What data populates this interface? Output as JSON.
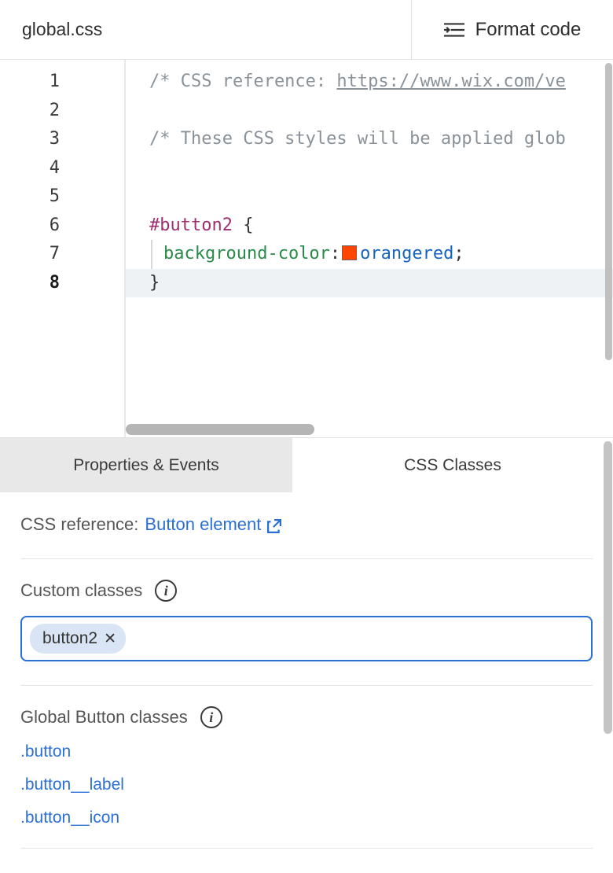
{
  "header": {
    "filename": "global.css",
    "format_label": "Format code"
  },
  "editor": {
    "line_numbers": [
      "1",
      "2",
      "3",
      "4",
      "5",
      "6",
      "7",
      "8"
    ],
    "active_line_index": 7,
    "lines": {
      "l1_comment_prefix": "/* CSS reference: ",
      "l1_link": "https://www.wix.com/ve",
      "l3_comment": "/* These CSS styles will be applied glob",
      "l6_selector": "#button2",
      "l6_brace": " {",
      "l7_property": "background-color",
      "l7_value": "orangered",
      "l8_brace": "}"
    },
    "swatch_color": "#ff4500"
  },
  "panel": {
    "tabs": {
      "properties": "Properties & Events",
      "css": "CSS Classes"
    },
    "reference_label": "CSS reference: ",
    "reference_link": "Button element",
    "custom_classes_label": "Custom classes",
    "custom_classes": [
      "button2"
    ],
    "global_label": "Global Button classes",
    "global_classes": [
      ".button",
      ".button__label",
      ".button__icon"
    ]
  }
}
